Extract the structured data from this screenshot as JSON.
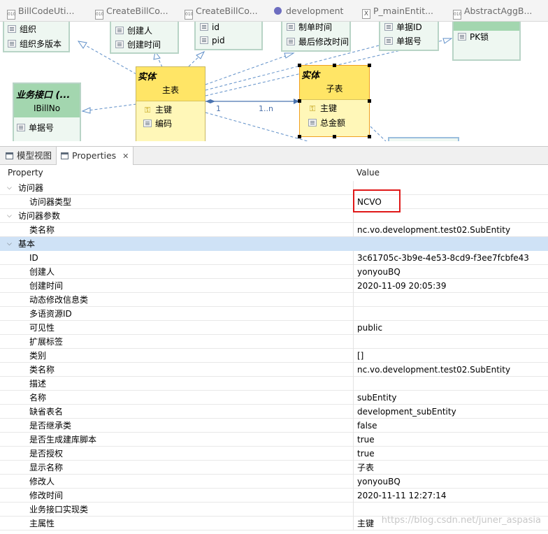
{
  "editor_tabs": [
    {
      "label": "BillCodeUti...",
      "icon": "java-file-icon"
    },
    {
      "label": "CreateBillCo...",
      "icon": "java-file-icon"
    },
    {
      "label": "CreateBillCo...",
      "icon": "java-file-icon"
    },
    {
      "label": "development",
      "icon": "model-icon"
    },
    {
      "label": "P_mainEntit...",
      "icon": "class-file-icon"
    },
    {
      "label": "AbstractAggB...",
      "icon": "java-file-icon"
    }
  ],
  "diagram": {
    "box_org": {
      "attrs": [
        "组织",
        "组织多版本"
      ]
    },
    "box_creator": {
      "attrs": [
        "创建人",
        "创建时间"
      ]
    },
    "box_id": {
      "attrs": [
        "id",
        "pid"
      ]
    },
    "box_bill": {
      "attrs": [
        "制单时间",
        "最后修改时间"
      ]
    },
    "box_billno": {
      "attrs": [
        "单据ID",
        "单据号"
      ]
    },
    "box_pk": {
      "attrs": [
        "PK锁"
      ]
    },
    "interface": {
      "stereotype": "业务接口 (...",
      "name": "IBillNo",
      "attrs": [
        "单据号"
      ]
    },
    "main_entity": {
      "stereotype": "实体",
      "name": "主表",
      "attrs": [
        "主键",
        "编码"
      ]
    },
    "sub_entity": {
      "stereotype": "实体",
      "name": "子表",
      "attrs": [
        "主键",
        "总金额"
      ]
    },
    "multiplicity_left": "1",
    "multiplicity_right": "1..n"
  },
  "view_tabs": [
    {
      "label": "模型视图",
      "active": false
    },
    {
      "label": "Properties",
      "active": true,
      "close": "✕"
    }
  ],
  "properties": {
    "col_property": "Property",
    "col_value": "Value",
    "rows": [
      {
        "level": 0,
        "expanded": true,
        "key": "访问器",
        "value": "",
        "selected": false
      },
      {
        "level": 1,
        "key": "访问器类型",
        "value": "NCVO",
        "selected": false
      },
      {
        "level": 0,
        "expanded": true,
        "key": "访问器参数",
        "value": "",
        "selected": false
      },
      {
        "level": 1,
        "key": "类名称",
        "value": "nc.vo.development.test02.SubEntity",
        "selected": false
      },
      {
        "level": 0,
        "expanded": true,
        "key": "基本",
        "value": "",
        "selected": true
      },
      {
        "level": 1,
        "key": "ID",
        "value": "3c61705c-3b9e-4e53-8cd9-f3ee7fcbfe43",
        "selected": false
      },
      {
        "level": 1,
        "key": "创建人",
        "value": "yonyouBQ",
        "selected": false
      },
      {
        "level": 1,
        "key": "创建时间",
        "value": "2020-11-09 20:05:39",
        "selected": false
      },
      {
        "level": 1,
        "key": "动态修改信息类",
        "value": "",
        "selected": false
      },
      {
        "level": 1,
        "key": "多语资源ID",
        "value": "",
        "selected": false
      },
      {
        "level": 1,
        "key": "可见性",
        "value": "public",
        "selected": false
      },
      {
        "level": 1,
        "key": "扩展标签",
        "value": "",
        "selected": false
      },
      {
        "level": 1,
        "key": "类别",
        "value": "[]",
        "selected": false
      },
      {
        "level": 1,
        "key": "类名称",
        "value": "nc.vo.development.test02.SubEntity",
        "selected": false
      },
      {
        "level": 1,
        "key": "描述",
        "value": "",
        "selected": false
      },
      {
        "level": 1,
        "key": "名称",
        "value": "subEntity",
        "selected": false
      },
      {
        "level": 1,
        "key": "缺省表名",
        "value": "development_subEntity",
        "selected": false
      },
      {
        "level": 1,
        "key": "是否继承类",
        "value": "false",
        "selected": false
      },
      {
        "level": 1,
        "key": "是否生成建库脚本",
        "value": "true",
        "selected": false
      },
      {
        "level": 1,
        "key": "是否授权",
        "value": "true",
        "selected": false
      },
      {
        "level": 1,
        "key": "显示名称",
        "value": "子表",
        "selected": false
      },
      {
        "level": 1,
        "key": "修改人",
        "value": "yonyouBQ",
        "selected": false
      },
      {
        "level": 1,
        "key": "修改时间",
        "value": "2020-11-11 12:27:14",
        "selected": false
      },
      {
        "level": 1,
        "key": "业务接口实现类",
        "value": "",
        "selected": false
      },
      {
        "level": 1,
        "key": "主属性",
        "value": "主键",
        "selected": false
      }
    ]
  },
  "watermark": "https://blog.csdn.net/juner_aspasia",
  "colors": {
    "entity_header": "#ffe566",
    "entity_body": "#fff7b8",
    "interface_header": "#a3d6af",
    "selection": "#cfe2f6",
    "highlight_box": "#e01818"
  }
}
